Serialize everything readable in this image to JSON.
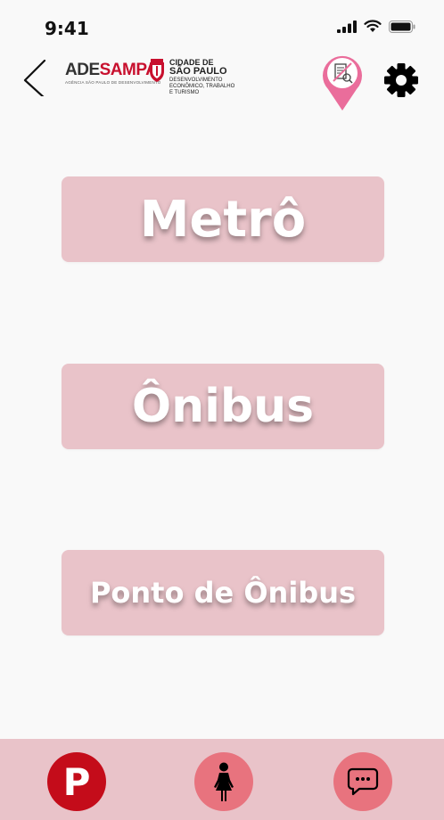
{
  "status_bar": {
    "time": "9:41"
  },
  "header": {
    "logo_ade": {
      "part1": "ADE",
      "part2": "SAMPA",
      "subtitle": "AGÊNCIA SÃO PAULO DE DESENVOLVIMENTO"
    },
    "logo_sp": {
      "line1": "CIDADE DE",
      "line2": "SÃO PAULO",
      "line3": "DESENVOLVIMENTO",
      "line4": "ECONÔMICO, TRABALHO",
      "line5": "E TURISMO"
    }
  },
  "main": {
    "buttons": [
      {
        "label": "Metrô"
      },
      {
        "label": "Ônibus"
      },
      {
        "label": "Ponto de Ônibus"
      }
    ]
  },
  "bottom_nav": {
    "parking_label": "P"
  },
  "colors": {
    "button_bg": "#e9c3c9",
    "nav_bg": "#e9c3c9",
    "accent_red": "#c40c1a",
    "accent_pink": "#e8737e",
    "pin_pink": "#ea6d9b"
  }
}
